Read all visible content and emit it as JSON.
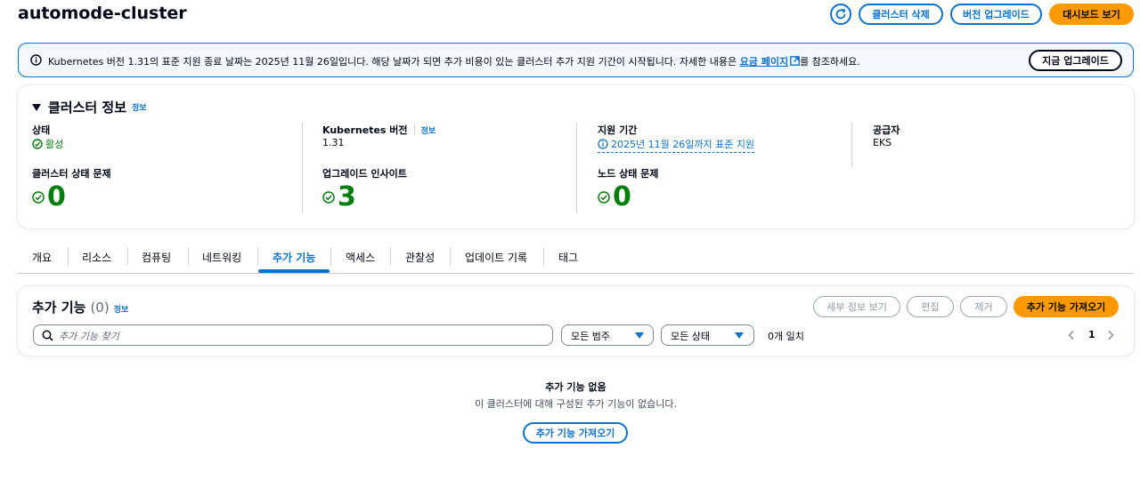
{
  "header": {
    "title": "automode-cluster",
    "delete_cluster": "클러스터 삭제",
    "upgrade_version": "버전 업그레이드",
    "view_dashboard": "대시보드 보기"
  },
  "banner": {
    "text_before": "Kubernetes 버전 1.31의 표준 지원 종료 날짜는 2025년 11월 26일입니다. 해당 날짜가 되면 추가 비용이 있는 클러스터 추가 지원 기간이 시작됩니다. 자세한 내용은 ",
    "link": "요금 페이지",
    "text_after": "를 참조하세요.",
    "upgrade_now": "지금 업그레이드"
  },
  "cluster_info": {
    "title": "클러스터 정보",
    "info": "정보",
    "status_label": "상태",
    "status_value": "활성",
    "k8s_label": "Kubernetes 버전",
    "k8s_info": "정보",
    "k8s_value": "1.31",
    "support_label": "지원 기간",
    "support_value": "2025년 11월 26일까지 표준 지원",
    "provider_label": "공급자",
    "provider_value": "EKS",
    "health_label": "클러스터 상태 문제",
    "health_value": "0",
    "insights_label": "업그레이드 인사이트",
    "insights_value": "3",
    "node_label": "노드 상태 문제",
    "node_value": "0"
  },
  "tabs": [
    "개요",
    "리소스",
    "컴퓨팅",
    "네트워킹",
    "추가 기능",
    "액세스",
    "관찰성",
    "업데이트 기록",
    "태그"
  ],
  "addons": {
    "title": "추가 기능",
    "count": "(0)",
    "info": "정보",
    "view_details": "세부 정보 보기",
    "edit": "편집",
    "remove": "제거",
    "get_more": "추가 기능 가져오기",
    "search_placeholder": "추가 기능 찾기",
    "category_select": "모든 범주",
    "status_select": "모든 상태",
    "match_count": "0개 일치",
    "page": "1",
    "empty_title": "추가 기능 없음",
    "empty_desc": "이 클러스터에 대해 구성된 추가 기능이 없습니다.",
    "empty_button": "추가 기능 가져오기"
  },
  "colors": {
    "accent": "#0972d3",
    "primary_button": "#ff9900",
    "success": "#037f0c",
    "banner_bg": "#f2f8fd"
  }
}
